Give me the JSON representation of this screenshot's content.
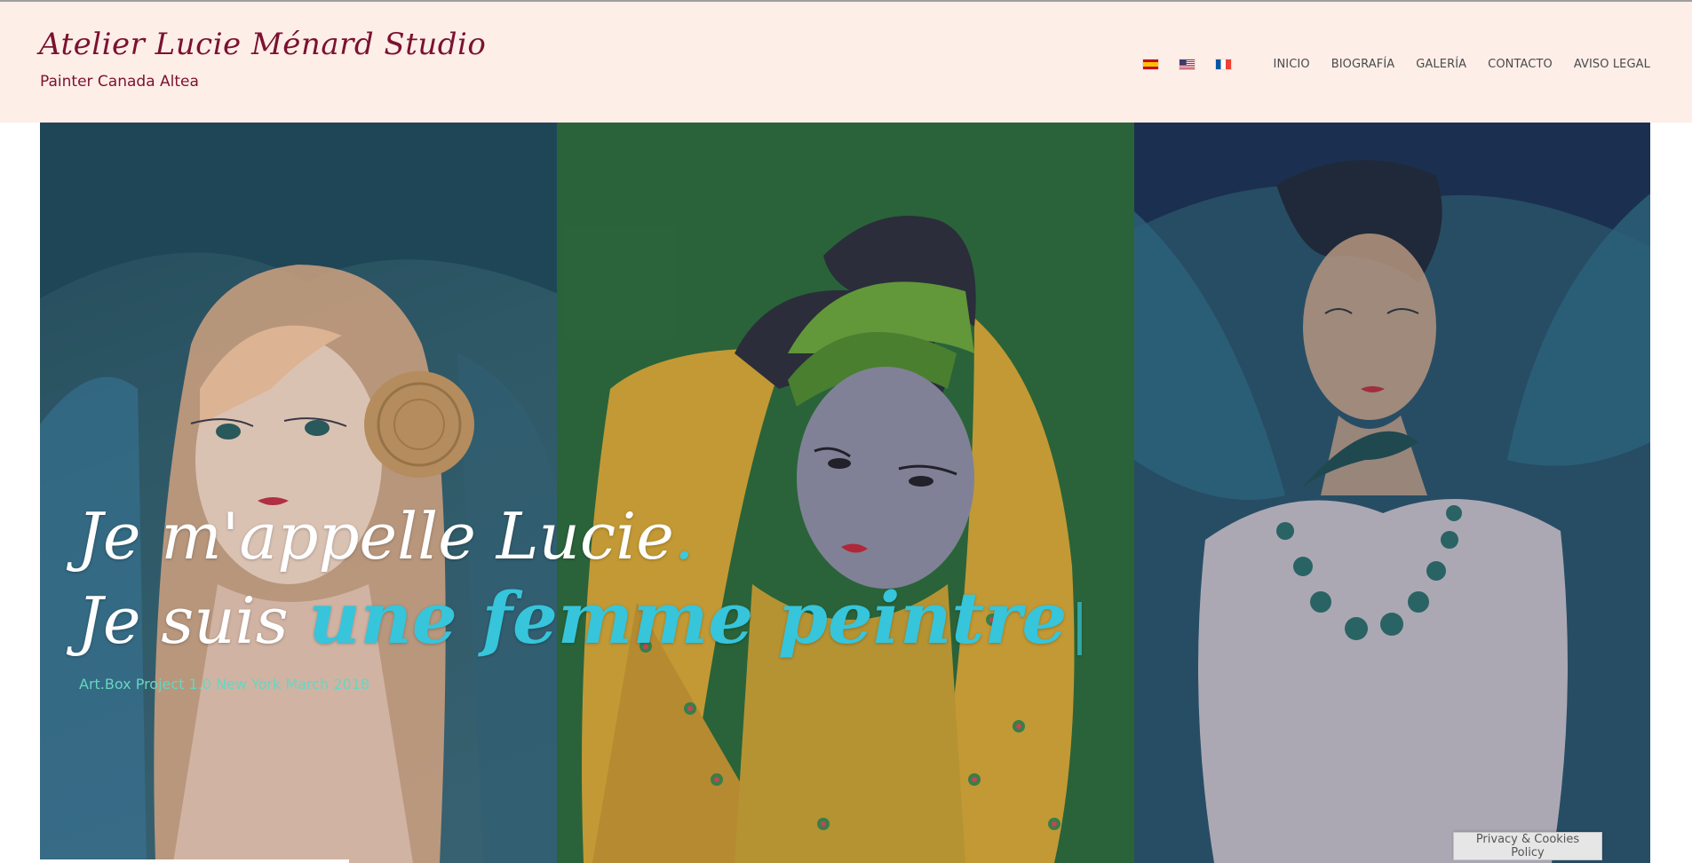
{
  "header": {
    "site_title": "Atelier Lucie Ménard Studio",
    "tagline": "Painter Canada Altea"
  },
  "nav": {
    "flags": [
      {
        "icon": "spain-flag-icon"
      },
      {
        "icon": "usa-flag-icon"
      },
      {
        "icon": "france-flag-icon"
      }
    ],
    "items": [
      {
        "label": "INICIO"
      },
      {
        "label": "BIOGRAFÍA"
      },
      {
        "label": "GALERÍA"
      },
      {
        "label": "CONTACTO"
      },
      {
        "label": "AVISO LEGAL"
      }
    ]
  },
  "hero": {
    "line1": "Je m'appelle Lucie",
    "line1_end": ".",
    "line2_prefix": "Je suis",
    "line2_accent": "une femme peintre",
    "cursor": "|",
    "caption": "Art.Box Project 1.0 New York March 2018"
  },
  "footer": {
    "cookie_button": "Privacy & Cookies Policy"
  },
  "colors": {
    "header_bg": "#feeee8",
    "title": "#7a1230",
    "accent": "#36c5db",
    "caption": "#67d6c2"
  }
}
